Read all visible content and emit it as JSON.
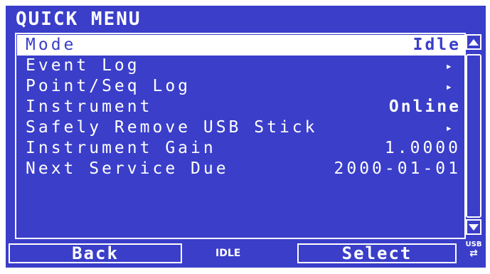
{
  "header": {
    "title": "QUICK MENU"
  },
  "menu": {
    "items": [
      {
        "label": "Mode",
        "value": "Idle"
      },
      {
        "label": "Event Log",
        "arrow": "▸"
      },
      {
        "label": "Point/Seq Log",
        "arrow": "▸"
      },
      {
        "label": "Instrument",
        "value": "Online"
      },
      {
        "label": "Safely Remove USB Stick",
        "arrow": "▸"
      },
      {
        "label": "Instrument Gain",
        "value": "1.0000"
      },
      {
        "label": "Next Service Due",
        "value": "2000-01-01"
      }
    ]
  },
  "footer": {
    "back_label": "Back",
    "status": "IDLE",
    "select_label": "Select",
    "usb_label": "USB",
    "usb_arrows": "⇄"
  },
  "icons": {
    "scroll_up": "scroll-up-icon",
    "scroll_down": "scroll-down-icon",
    "usb": "usb-icon"
  },
  "colors": {
    "background": "#3a3ec9",
    "foreground": "#ffffff"
  }
}
